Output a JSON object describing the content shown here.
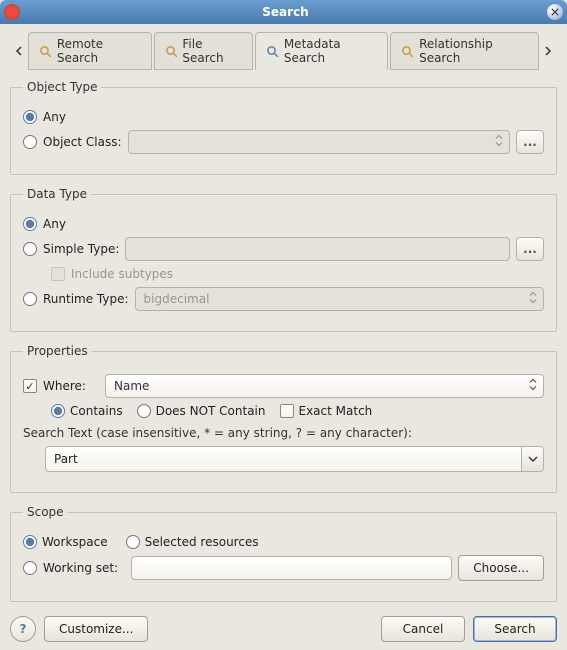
{
  "window": {
    "title": "Search"
  },
  "tabs": {
    "items": [
      {
        "label": "Remote Search"
      },
      {
        "label": "File Search"
      },
      {
        "label": "Metadata Search"
      },
      {
        "label": "Relationship Search"
      }
    ],
    "active_index": 2
  },
  "object_type": {
    "legend": "Object Type",
    "any_label": "Any",
    "object_class_label": "Object Class:",
    "object_class_value": "",
    "browse_label": "..."
  },
  "data_type": {
    "legend": "Data Type",
    "any_label": "Any",
    "simple_type_label": "Simple Type:",
    "simple_type_value": "",
    "browse_label": "...",
    "include_subtypes_label": "Include subtypes",
    "runtime_type_label": "Runtime Type:",
    "runtime_type_value": "bigdecimal"
  },
  "properties": {
    "legend": "Properties",
    "where_label": "Where:",
    "where_value": "Name",
    "contains_label": "Contains",
    "does_not_contain_label": "Does NOT Contain",
    "exact_match_label": "Exact Match",
    "hint": "Search Text (case insensitive, * = any string, ? = any character):",
    "search_text": "Part"
  },
  "scope": {
    "legend": "Scope",
    "workspace_label": "Workspace",
    "selected_resources_label": "Selected resources",
    "working_set_label": "Working set:",
    "working_set_value": "",
    "choose_label": "Choose..."
  },
  "buttons": {
    "help": "?",
    "customize": "Customize...",
    "cancel": "Cancel",
    "search": "Search"
  }
}
